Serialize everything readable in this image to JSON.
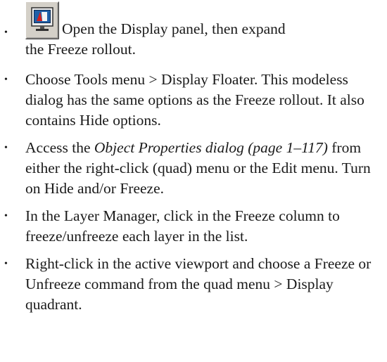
{
  "bullets": [
    {
      "icon": "display-panel-icon",
      "line1": "Open the Display panel, then expand",
      "line2": "the Freeze rollout."
    },
    {
      "text": "Choose Tools menu > Display Floater.  This modeless dialog has the same options as the Freeze rollout. It also contains Hide options."
    },
    {
      "before": "Access the ",
      "link": "Object Properties dialog (page 1–117)",
      "after": " from either the right-click (quad) menu or the Edit menu. Turn on Hide and/or Freeze."
    },
    {
      "text": "In the Layer Manager, click in the Freeze column to freeze/unfreeze each layer in the list."
    },
    {
      "text": "Right-click in the active viewport and choose a Freeze or Unfreeze command from the quad menu > Display quadrant."
    }
  ],
  "bullet_char": "•",
  "colors": {
    "text": "#1a1a1a",
    "icon_face": "#d4d0c8",
    "icon_screen": "#2b78c4"
  }
}
